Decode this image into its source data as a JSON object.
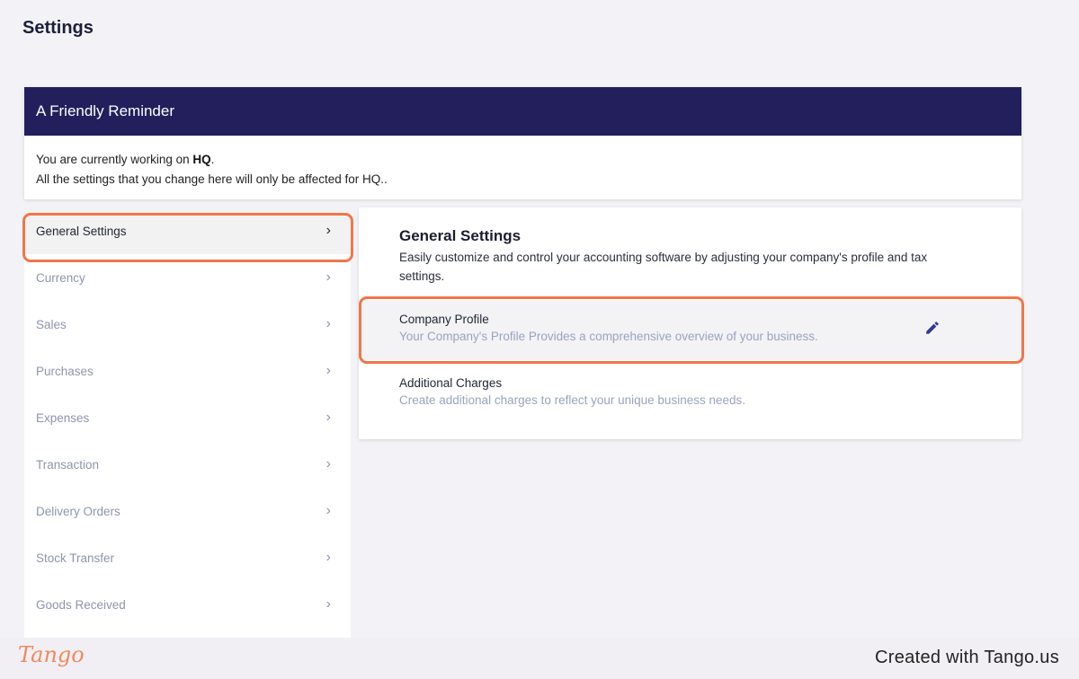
{
  "page": {
    "title": "Settings"
  },
  "reminder": {
    "title": "A Friendly Reminder",
    "line1_prefix": "You are currently working on ",
    "line1_bold": "HQ",
    "line1_suffix": ".",
    "line2": "All the settings that you change here will only be affected for HQ.."
  },
  "sidebar": {
    "items": [
      {
        "label": "General Settings",
        "active": true
      },
      {
        "label": "Currency"
      },
      {
        "label": "Sales"
      },
      {
        "label": "Purchases"
      },
      {
        "label": "Expenses"
      },
      {
        "label": "Transaction"
      },
      {
        "label": "Delivery Orders"
      },
      {
        "label": "Stock Transfer"
      },
      {
        "label": "Goods Received"
      }
    ]
  },
  "panel": {
    "title": "General Settings",
    "description": "Easily customize and control your accounting software by adjusting your company's profile and tax settings.",
    "options": [
      {
        "title": "Company Profile",
        "subtitle": "Your Company's Profile Provides a comprehensive overview of your business.",
        "icon": "pencil-icon"
      },
      {
        "title": "Additional Charges",
        "subtitle": "Create additional charges to reflect your unique business needs."
      }
    ]
  },
  "footer": {
    "logo": "Tango",
    "credit": "Created with Tango.us"
  },
  "colors": {
    "header_bg": "#221f5c",
    "highlight": "#f0764a",
    "muted_text": "#8d95ad",
    "edit_icon": "#2e3a8c"
  }
}
